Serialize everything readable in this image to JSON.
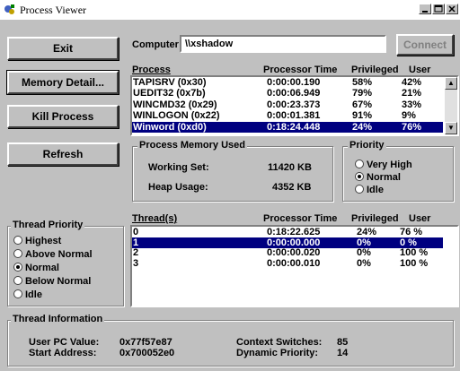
{
  "window": {
    "title": "Process Viewer"
  },
  "buttons": {
    "exit": "Exit",
    "memory": "Memory Detail...",
    "kill": "Kill Process",
    "refresh": "Refresh",
    "connect": "Connect"
  },
  "computer": {
    "label": "Computer:",
    "value": "\\\\xshadow"
  },
  "process_list": {
    "headers": [
      "Process",
      "Processor Time",
      "Privileged",
      "User"
    ],
    "rows": [
      [
        "TAPISRV (0x30)",
        "0:00:00.190",
        "58%",
        "42%"
      ],
      [
        "UEDIT32 (0x7b)",
        "0:00:06.949",
        "79%",
        "21%"
      ],
      [
        "WINCMD32 (0x29)",
        "0:00:23.373",
        "67%",
        "33%"
      ],
      [
        "WINLOGON (0x22)",
        "0:00:01.381",
        "91%",
        "9%"
      ],
      [
        "Winword (0xd0)",
        "0:18:24.448",
        "24%",
        "76%"
      ]
    ],
    "selected": 4
  },
  "memory": {
    "title": "Process Memory Used",
    "working_set_label": "Working Set:",
    "working_set": "11420 KB",
    "heap_label": "Heap Usage:",
    "heap": "4352 KB"
  },
  "priority": {
    "title": "Priority",
    "options": [
      "Very High",
      "Normal",
      "Idle"
    ],
    "selected": 1
  },
  "thread_priority": {
    "title": "Thread Priority",
    "options": [
      "Highest",
      "Above Normal",
      "Normal",
      "Below Normal",
      "Idle"
    ],
    "selected": 2
  },
  "thread_list": {
    "headers": [
      "Thread(s)",
      "Processor Time",
      "Privileged",
      "User"
    ],
    "rows": [
      [
        "0",
        "0:18:22.625",
        "24%",
        "76 %"
      ],
      [
        "1",
        "0:00:00.000",
        "0%",
        "0 %"
      ],
      [
        "2",
        "0:00:00.020",
        "0%",
        "100 %"
      ],
      [
        "3",
        "0:00:00.010",
        "0%",
        "100 %"
      ]
    ],
    "selected": 1
  },
  "thread_info": {
    "title": "Thread Information",
    "user_pc_label": "User PC Value:",
    "user_pc": "0x77f57e87",
    "start_label": "Start Address:",
    "start": "0x700052e0",
    "ctx_label": "Context Switches:",
    "ctx": "85",
    "dyn_label": "Dynamic Priority:",
    "dyn": "14"
  }
}
